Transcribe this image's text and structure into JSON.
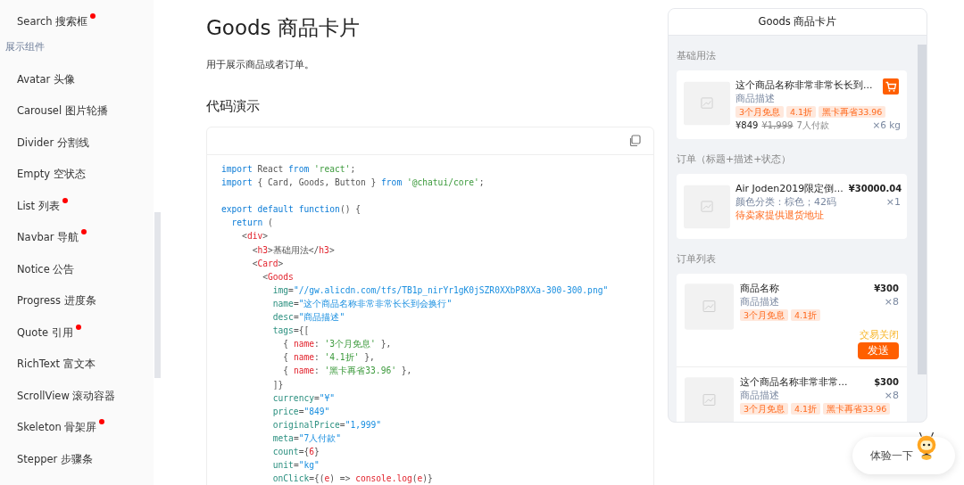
{
  "sidebar": {
    "items": [
      {
        "kind": "link",
        "label": "Search 搜索框",
        "new_dot": true
      },
      {
        "kind": "group",
        "label": "展示组件"
      },
      {
        "kind": "link",
        "label": "Avatar 头像",
        "new_dot": false
      },
      {
        "kind": "link",
        "label": "Carousel 图片轮播",
        "new_dot": false
      },
      {
        "kind": "link",
        "label": "Divider 分割线",
        "new_dot": false
      },
      {
        "kind": "link",
        "label": "Empty 空状态",
        "new_dot": false
      },
      {
        "kind": "link",
        "label": "List 列表",
        "new_dot": true
      },
      {
        "kind": "link",
        "label": "Navbar 导航",
        "new_dot": true
      },
      {
        "kind": "link",
        "label": "Notice 公告",
        "new_dot": false
      },
      {
        "kind": "link",
        "label": "Progress 进度条",
        "new_dot": false
      },
      {
        "kind": "link",
        "label": "Quote 引用",
        "new_dot": true
      },
      {
        "kind": "link",
        "label": "RichText 富文本",
        "new_dot": false
      },
      {
        "kind": "link",
        "label": "ScrollView 滚动容器",
        "new_dot": false
      },
      {
        "kind": "link",
        "label": "Skeleton 骨架屏",
        "new_dot": true
      },
      {
        "kind": "link",
        "label": "Stepper 步骤条",
        "new_dot": false
      }
    ]
  },
  "page": {
    "title": "Goods 商品卡片",
    "description": "用于展示商品或者订单。",
    "section_title": "代码演示"
  },
  "code": [
    [
      "import React from 'react';",
      "import { Card, Goods, Button } from '@chatui/core';"
    ],
    [
      "export default function() {",
      "  return (",
      "    <div>",
      "      <h3>基础用法</h3>",
      "      <Card>",
      "        <Goods",
      "          img=\"//gw.alicdn.com/tfs/TB1p_nirYr1gK0jSZR0XXbP8XXa-300-300.png\"",
      "          name=\"这个商品名称非常非常长长到会换行\"",
      "          desc=\"商品描述\"",
      "          tags={[",
      "            { name: '3个月免息' },",
      "            { name: '4.1折' },",
      "            { name: '黑卡再省33.96' },",
      "          ]}",
      "          currency=\"¥\"",
      "          price=\"849\"",
      "          originalPrice=\"1,999\"",
      "          meta=\"7人付款\"",
      "          count={6}",
      "          unit=\"kg\"",
      "          onClick={(e) => console.log(e)}"
    ]
  ],
  "demo": {
    "title": "Goods 商品卡片",
    "basic": {
      "label": "基础用法",
      "name": "这个商品名称非常非常长长到...",
      "desc": "商品描述",
      "tags": [
        "3个月免息",
        "4.1折",
        "黑卡再省33.96"
      ],
      "price": "¥849",
      "original_price": "¥1,999",
      "meta": "7人付款",
      "count": "×6 kg"
    },
    "order": {
      "label": "订单（标题+描述+状态）",
      "name": "Air Joden2019限定倒...",
      "price": "¥30000.04",
      "desc": "颜色分类：棕色；42码",
      "count": "×1",
      "status": "待卖家提供退货地址"
    },
    "order_list": {
      "label": "订单列表",
      "items": [
        {
          "name": "商品名称",
          "price": "¥300",
          "desc": "商品描述",
          "count": "×8",
          "tags": [
            "3个月免息",
            "4.1折"
          ],
          "status": "交易关闭",
          "button": "发送"
        },
        {
          "name": "这个商品名称非常非常...",
          "price": "$300",
          "desc": "商品描述",
          "count": "×8",
          "tags": [
            "3个月免息",
            "4.1折",
            "黑卡再省33.96"
          ]
        }
      ]
    }
  },
  "try_button": {
    "label": "体验一下"
  }
}
